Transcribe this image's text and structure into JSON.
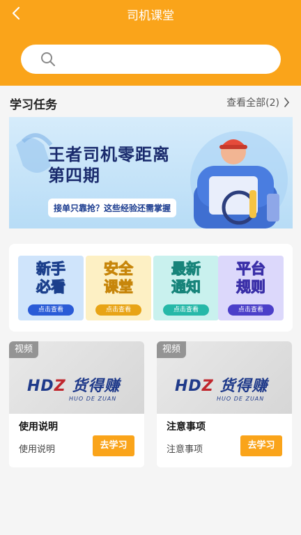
{
  "header": {
    "title": "司机课堂",
    "back_icon": "chevron-left-icon"
  },
  "search": {
    "placeholder": "",
    "icon": "search-icon"
  },
  "section": {
    "title": "学习任务",
    "view_all": "查看全部(2)"
  },
  "banner": {
    "line1": "王者司机零距离",
    "line2": "第四期",
    "subtitle": "接单只靠抢？这些经验还需掌握"
  },
  "categories": [
    {
      "label1": "新手",
      "label2": "必看",
      "button": "点击查看",
      "bg": "#cfe4fb",
      "btn_color": "#2a5bd7"
    },
    {
      "label1": "安全",
      "label2": "课堂",
      "button": "点击查看",
      "bg": "#fdf0c4",
      "btn_color": "#e8a416"
    },
    {
      "label1": "最新",
      "label2": "通知",
      "button": "点击查看",
      "bg": "#c9f1ee",
      "btn_color": "#26b8a8"
    },
    {
      "label1": "平台",
      "label2": "规则",
      "button": "点击查看",
      "bg": "#dcd8fb",
      "btn_color": "#4b3fc9"
    }
  ],
  "videos": [
    {
      "tag": "视频",
      "logo_prefix": "HD",
      "logo_z": "Z",
      "logo_cn": "货得赚",
      "logo_sub": "HUO DE ZUAN",
      "title": "使用说明",
      "desc": "使用说明",
      "button": "去学习"
    },
    {
      "tag": "视频",
      "logo_prefix": "HD",
      "logo_z": "Z",
      "logo_cn": "货得赚",
      "logo_sub": "HUO DE ZUAN",
      "title": "注意事项",
      "desc": "注意事项",
      "button": "去学习"
    }
  ],
  "colors": {
    "accent": "#faa41a",
    "background": "#f5f5f5"
  }
}
